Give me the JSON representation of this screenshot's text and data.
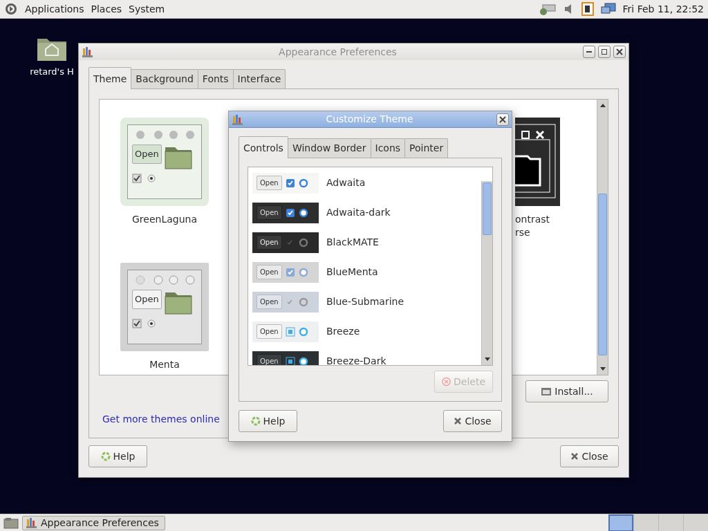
{
  "top_panel": {
    "menus": [
      {
        "label": "Applications"
      },
      {
        "label": "Places"
      },
      {
        "label": "System"
      }
    ],
    "clock": "Fri Feb 11, 22:52"
  },
  "desktop_icons": [
    {
      "label": "retard's H"
    }
  ],
  "main_window": {
    "title": "Appearance Preferences",
    "tabs": [
      {
        "label": "Theme",
        "selected": true
      },
      {
        "label": "Background",
        "selected": false
      },
      {
        "label": "Fonts",
        "selected": false
      },
      {
        "label": "Interface",
        "selected": false
      }
    ],
    "themes": [
      {
        "name_lines": [
          "GreenLaguna"
        ],
        "kind": "green",
        "button_label": "Open"
      },
      {
        "name_lines": [
          "ontrast",
          "rse"
        ],
        "kind": "contrast"
      },
      {
        "name_lines": [
          "Menta"
        ],
        "kind": "gray",
        "button_label": "Open"
      }
    ],
    "link": "Get more themes online",
    "install_button": "Install...",
    "help_button": "Help",
    "close_button": "Close"
  },
  "dialog": {
    "title": "Customize Theme",
    "tabs": [
      {
        "label": "Controls",
        "selected": true
      },
      {
        "label": "Window Border",
        "selected": false
      },
      {
        "label": "Icons",
        "selected": false
      },
      {
        "label": "Pointer",
        "selected": false
      }
    ],
    "themes": [
      {
        "name": "Adwaita",
        "kind": "light",
        "button_label": "Open"
      },
      {
        "name": "Adwaita-dark",
        "kind": "dark",
        "button_label": "Open"
      },
      {
        "name": "BlackMATE",
        "kind": "black",
        "button_label": "Open"
      },
      {
        "name": "BlueMenta",
        "kind": "gray",
        "button_label": "Open"
      },
      {
        "name": "Blue-Submarine",
        "kind": "gray2",
        "button_label": "Open"
      },
      {
        "name": "Breeze",
        "kind": "breeze",
        "button_label": "Open"
      },
      {
        "name": "Breeze-Dark",
        "kind": "breezedark",
        "button_label": "Open"
      }
    ],
    "delete_button": {
      "label": "Delete",
      "disabled": true
    },
    "help_button": "Help",
    "close_button": "Close"
  },
  "taskbar": {
    "tasks": [
      {
        "label": "Appearance Preferences"
      }
    ],
    "workspaces": [
      {
        "selected": true
      },
      {
        "selected": false
      },
      {
        "selected": false
      },
      {
        "selected": false
      }
    ]
  }
}
